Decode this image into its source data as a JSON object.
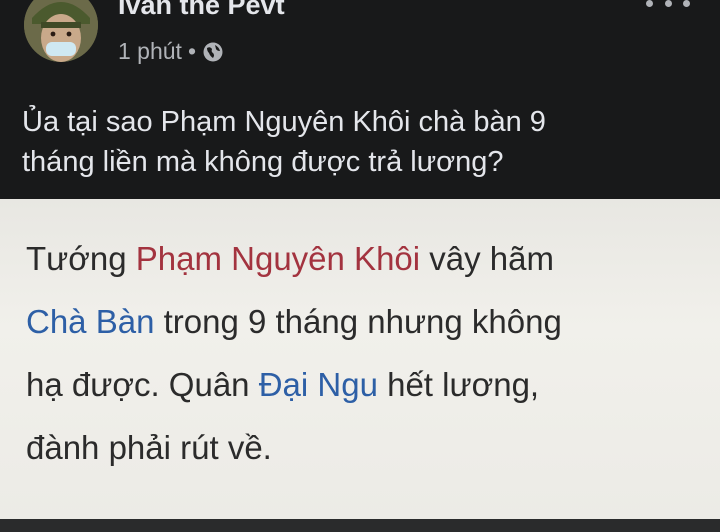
{
  "post": {
    "author": "Ivan the Pevt",
    "time": "1 phút",
    "separator": "•",
    "privacy_icon": "globe-icon",
    "more_icon": "more-options-icon",
    "text_line1": "Ủa tại sao Phạm Nguyên Khôi chà bàn 9",
    "text_line2": "tháng liền mà không được trả lương?"
  },
  "image": {
    "seg_1": "Tướng ",
    "seg_2": "Phạm Nguyên Khôi",
    "seg_3": " vây hãm",
    "seg_4": "Chà Bàn",
    "seg_5": " trong 9 tháng nhưng không",
    "seg_6": "hạ được. Quân ",
    "seg_7": "Đại Ngu",
    "seg_8": " hết lương,",
    "seg_9": "đành phải rút về."
  },
  "colors": {
    "background": "#18191a",
    "text_primary": "#e4e6eb",
    "text_secondary": "#b0b3b8",
    "link_red": "#a3333f",
    "link_blue": "#2d5fa6"
  }
}
